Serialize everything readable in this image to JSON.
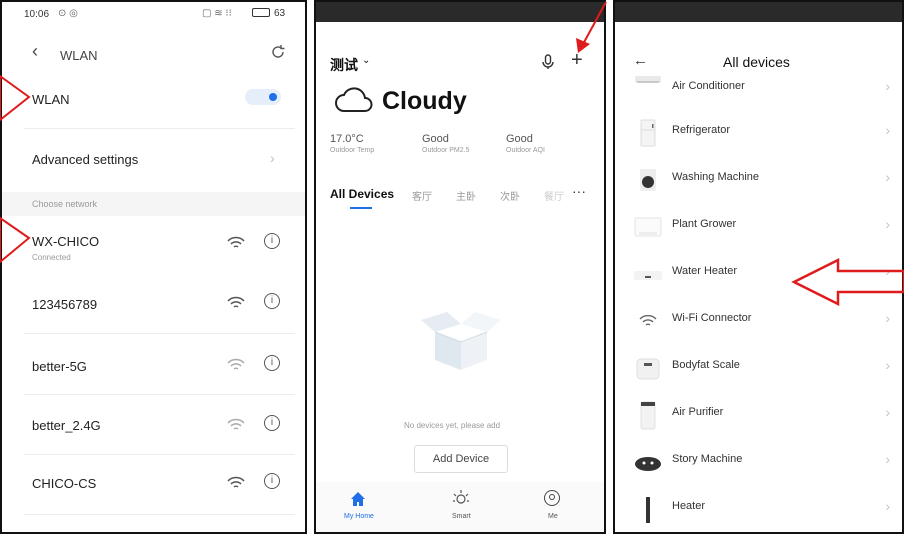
{
  "wlan_panel": {
    "status_time": "10:06",
    "battery": "63",
    "header_title": "WLAN",
    "wlan_toggle_label": "WLAN",
    "wlan_enabled": true,
    "advanced_settings": "Advanced settings",
    "choose_network": "Choose network",
    "networks": [
      {
        "ssid": "WX-CHICO",
        "status": "Connected"
      },
      {
        "ssid": "123456789",
        "status": ""
      },
      {
        "ssid": "better-5G",
        "status": ""
      },
      {
        "ssid": "better_2.4G",
        "status": ""
      },
      {
        "ssid": "CHICO-CS",
        "status": ""
      }
    ]
  },
  "home_panel": {
    "home_name": "测试",
    "weather": "Cloudy",
    "stats": [
      {
        "value": "17.0°C",
        "label": "Outdoor Temp"
      },
      {
        "value": "Good",
        "label": "Outdoor PM2.5"
      },
      {
        "value": "Good",
        "label": "Outdoor AQI"
      }
    ],
    "tabs": [
      "All Devices",
      "客厅",
      "主卧",
      "次卧",
      "餐厅"
    ],
    "empty_text": "No devices yet, please add",
    "add_button": "Add Device",
    "bottom_nav": [
      "My Home",
      "Smart",
      "Me"
    ]
  },
  "devices_panel": {
    "title": "All devices",
    "devices": [
      {
        "label": "Air Conditioner",
        "icon": "air-conditioner-icon"
      },
      {
        "label": "Refrigerator",
        "icon": "refrigerator-icon"
      },
      {
        "label": "Washing Machine",
        "icon": "washing-machine-icon"
      },
      {
        "label": "Plant Grower",
        "icon": "plant-grower-icon"
      },
      {
        "label": "Water Heater",
        "icon": "water-heater-icon"
      },
      {
        "label": "Wi-Fi Connector",
        "icon": "wifi-connector-icon"
      },
      {
        "label": "Bodyfat Scale",
        "icon": "bodyfat-scale-icon"
      },
      {
        "label": "Air Purifier",
        "icon": "air-purifier-icon"
      },
      {
        "label": "Story Machine",
        "icon": "story-machine-icon"
      },
      {
        "label": "Heater",
        "icon": "heater-icon"
      }
    ]
  },
  "colors": {
    "accent": "#1e6fe8",
    "annotation_red": "#e01b1b"
  }
}
